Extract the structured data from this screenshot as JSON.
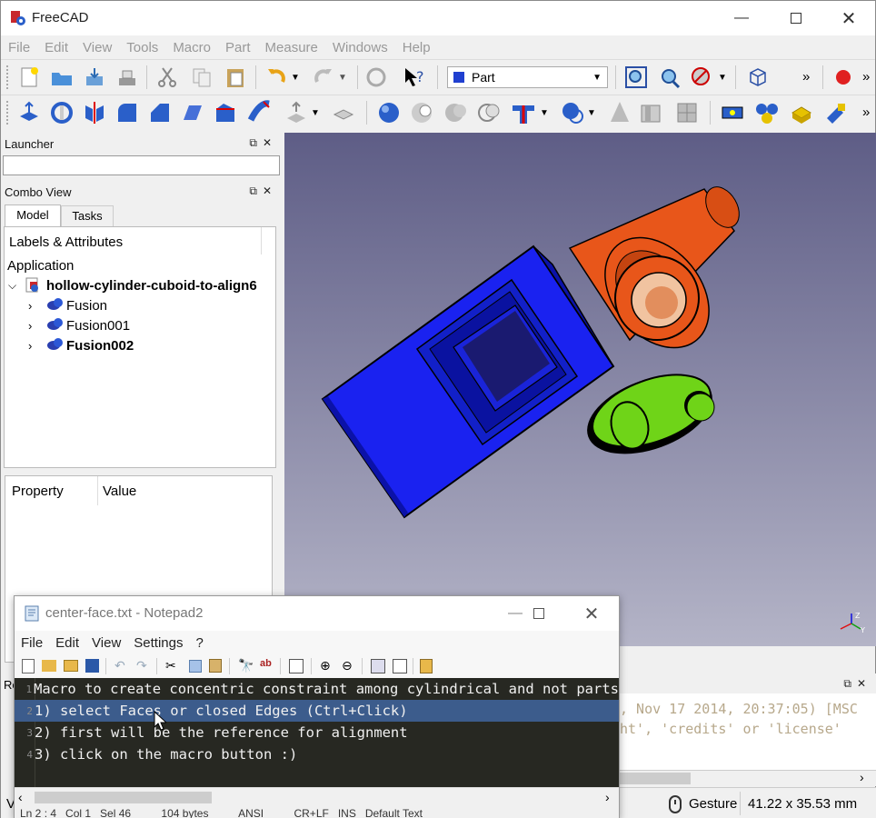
{
  "app": {
    "title": "FreeCAD",
    "menus": [
      "File",
      "Edit",
      "View",
      "Tools",
      "Macro",
      "Part",
      "Measure",
      "Windows",
      "Help"
    ],
    "workbench": "Part",
    "overflow": "»"
  },
  "launcher": {
    "title": "Launcher"
  },
  "combo": {
    "title": "Combo View",
    "tabs": [
      "Model",
      "Tasks"
    ],
    "tree_header": "Labels & Attributes",
    "application": "Application",
    "document": "hollow-cylinder-cuboid-to-align6",
    "items": [
      "Fusion",
      "Fusion001",
      "Fusion002"
    ]
  },
  "property": {
    "col1": "Property",
    "col2": "Value"
  },
  "notepad": {
    "title": "center-face.txt - Notepad2",
    "menus": [
      "File",
      "Edit",
      "View",
      "Settings",
      "?"
    ],
    "lines": [
      {
        "num": "1",
        "text": "Macro to create concentric constraint among cylindrical and not parts"
      },
      {
        "num": "2",
        "text": "1) select Faces or closed Edges (Ctrl+Click)"
      },
      {
        "num": "3",
        "text": "2) first will be the reference for alignment"
      },
      {
        "num": "4",
        "text": "3) click on the macro button :)"
      }
    ],
    "status": "Ln 2 : 4   Col 1   Sel 46          104 bytes          ANSI          CR+LF   INS   Default Text"
  },
  "report": {
    "line1": ", Nov 17 2014, 20:37:05) [MSC",
    "line2": "ht', 'credits' or 'license'",
    "corner_label": "Re"
  },
  "statusbar": {
    "nav": "Gesture",
    "dims": "41.22 x 35.53 mm",
    "left": "V"
  },
  "colors": {
    "blue_part": "#1020e8",
    "orange_part": "#e8561a",
    "green_part": "#6fd418",
    "viewport_top": "#5e5d86",
    "viewport_bottom": "#b4b4c7"
  }
}
